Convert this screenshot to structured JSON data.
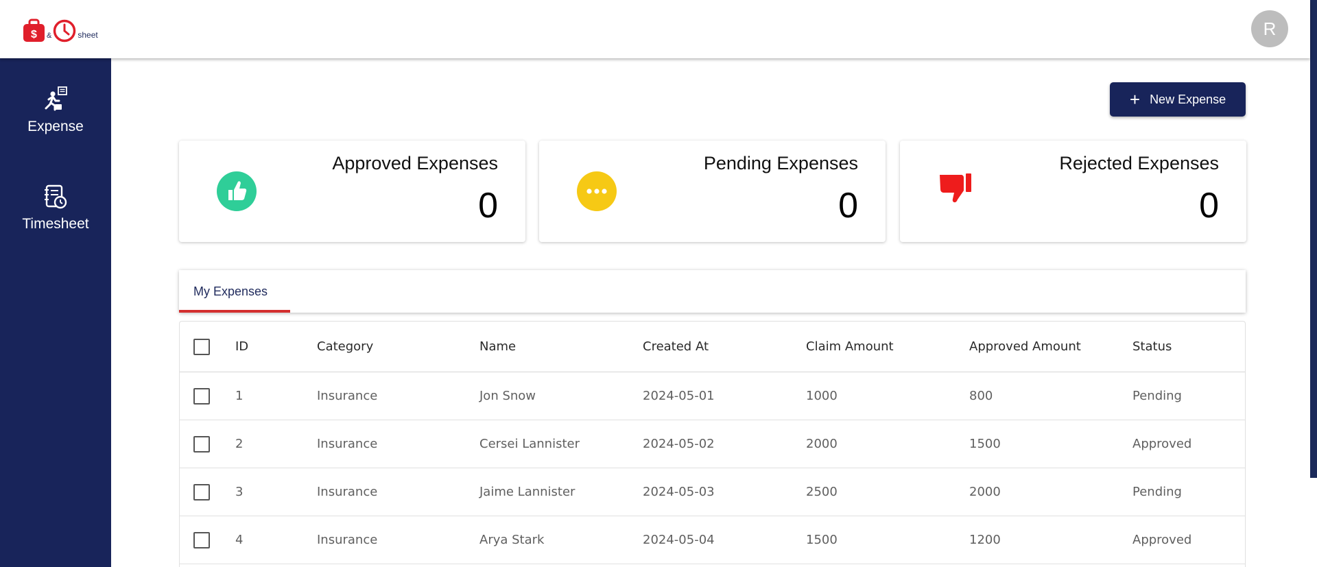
{
  "header": {
    "logo": {
      "ampersand": "&",
      "suffix": "sheet",
      "bag_symbol": "$"
    },
    "avatar_initial": "R"
  },
  "sidebar": {
    "items": [
      {
        "label": "Expense",
        "icon": "expense-person-icon"
      },
      {
        "label": "Timesheet",
        "icon": "timesheet-clock-icon"
      }
    ]
  },
  "toolbar": {
    "new_expense_label": "New Expense",
    "plus": "+"
  },
  "stats": {
    "approved": {
      "title": "Approved Expenses",
      "count": "0",
      "icon": "thumbs-up-icon",
      "color": "#2fce98"
    },
    "pending": {
      "title": "Pending Expenses",
      "count": "0",
      "icon": "more-dots-icon",
      "color": "#f6c915"
    },
    "rejected": {
      "title": "Rejected Expenses",
      "count": "0",
      "icon": "thumbs-down-icon",
      "color": "#ee1c1c"
    }
  },
  "tabs": [
    {
      "label": "My Expenses",
      "active": true
    }
  ],
  "table": {
    "columns": [
      "ID",
      "Category",
      "Name",
      "Created At",
      "Claim Amount",
      "Approved Amount",
      "Status"
    ],
    "rows": [
      {
        "id": "1",
        "category": "Insurance",
        "name": "Jon Snow",
        "created_at": "2024-05-01",
        "claim_amount": "1000",
        "approved_amount": "800",
        "status": "Pending"
      },
      {
        "id": "2",
        "category": "Insurance",
        "name": "Cersei Lannister",
        "created_at": "2024-05-02",
        "claim_amount": "2000",
        "approved_amount": "1500",
        "status": "Approved"
      },
      {
        "id": "3",
        "category": "Insurance",
        "name": "Jaime Lannister",
        "created_at": "2024-05-03",
        "claim_amount": "2500",
        "approved_amount": "2000",
        "status": "Pending"
      },
      {
        "id": "4",
        "category": "Insurance",
        "name": "Arya Stark",
        "created_at": "2024-05-04",
        "claim_amount": "1500",
        "approved_amount": "1200",
        "status": "Approved"
      }
    ]
  },
  "colors": {
    "brand_navy": "#18245a",
    "accent_red": "#d32f2f",
    "logo_red": "#e01f2b"
  }
}
